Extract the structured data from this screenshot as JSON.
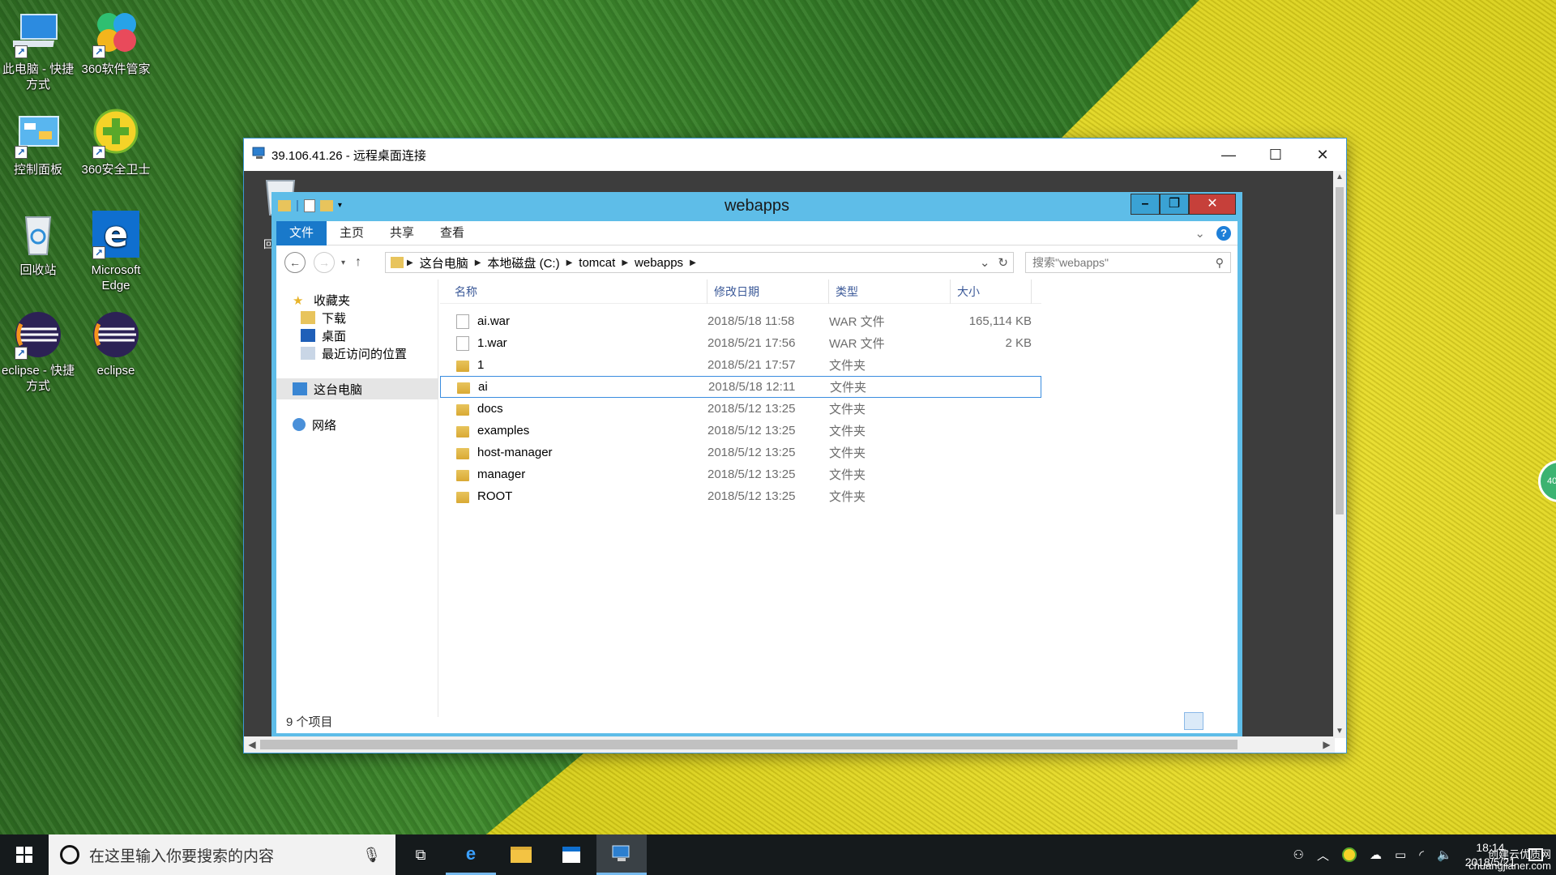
{
  "desktop": {
    "icons": [
      {
        "label": "此电脑 - 快捷方式",
        "icon": "computer-icon"
      },
      {
        "label": "360软件管家",
        "icon": "360-soft-icon"
      },
      {
        "label": "控制面板",
        "icon": "control-panel-icon"
      },
      {
        "label": "360安全卫士",
        "icon": "360-safe-icon"
      },
      {
        "label": "回收站",
        "icon": "recycle-bin-icon"
      },
      {
        "label": "Microsoft Edge",
        "icon": "edge-icon"
      },
      {
        "label": "eclipse - 快捷方式",
        "icon": "eclipse-icon"
      },
      {
        "label": "eclipse",
        "icon": "eclipse-icon"
      }
    ],
    "side_badge": "40"
  },
  "rdp_window": {
    "title": "39.106.41.26 - 远程桌面连接",
    "minimize": "—",
    "maximize": "☐",
    "close": "✕"
  },
  "explorer": {
    "title": "webapps",
    "ribbon_tabs": [
      "文件",
      "主页",
      "共享",
      "查看"
    ],
    "active_tab": "文件",
    "breadcrumb": [
      "这台电脑",
      "本地磁盘 (C:)",
      "tomcat",
      "webapps"
    ],
    "search_placeholder": "搜索\"webapps\"",
    "nav": {
      "favorites": "收藏夹",
      "downloads": "下载",
      "desktop": "桌面",
      "recent": "最近访问的位置",
      "this_pc": "这台电脑",
      "network": "网络"
    },
    "columns": [
      "名称",
      "修改日期",
      "类型",
      "大小"
    ],
    "files": [
      {
        "name": "ai.war",
        "date": "2018/5/18 11:58",
        "type": "WAR 文件",
        "size": "165,114 KB",
        "kind": "file"
      },
      {
        "name": "1.war",
        "date": "2018/5/21 17:56",
        "type": "WAR 文件",
        "size": "2 KB",
        "kind": "file"
      },
      {
        "name": "1",
        "date": "2018/5/21 17:57",
        "type": "文件夹",
        "size": "",
        "kind": "folder"
      },
      {
        "name": "ai",
        "date": "2018/5/18 12:11",
        "type": "文件夹",
        "size": "",
        "kind": "folder"
      },
      {
        "name": "docs",
        "date": "2018/5/12 13:25",
        "type": "文件夹",
        "size": "",
        "kind": "folder"
      },
      {
        "name": "examples",
        "date": "2018/5/12 13:25",
        "type": "文件夹",
        "size": "",
        "kind": "folder"
      },
      {
        "name": "host-manager",
        "date": "2018/5/12 13:25",
        "type": "文件夹",
        "size": "",
        "kind": "folder"
      },
      {
        "name": "manager",
        "date": "2018/5/12 13:25",
        "type": "文件夹",
        "size": "",
        "kind": "folder"
      },
      {
        "name": "ROOT",
        "date": "2018/5/12 13:25",
        "type": "文件夹",
        "size": "",
        "kind": "folder"
      }
    ],
    "selected_file": "ai",
    "status": "9 个项目",
    "recycle_partial": "回"
  },
  "taskbar": {
    "search_placeholder": "在这里输入你要搜索的内容",
    "apps": [
      "task-view-icon",
      "edge-icon",
      "file-explorer-icon",
      "store-icon",
      "remote-desktop-icon"
    ],
    "time": "18:14",
    "date": "2018/5/21",
    "watermark_line1": "创建云优质网",
    "watermark_line2": "chuangjianer.com"
  }
}
